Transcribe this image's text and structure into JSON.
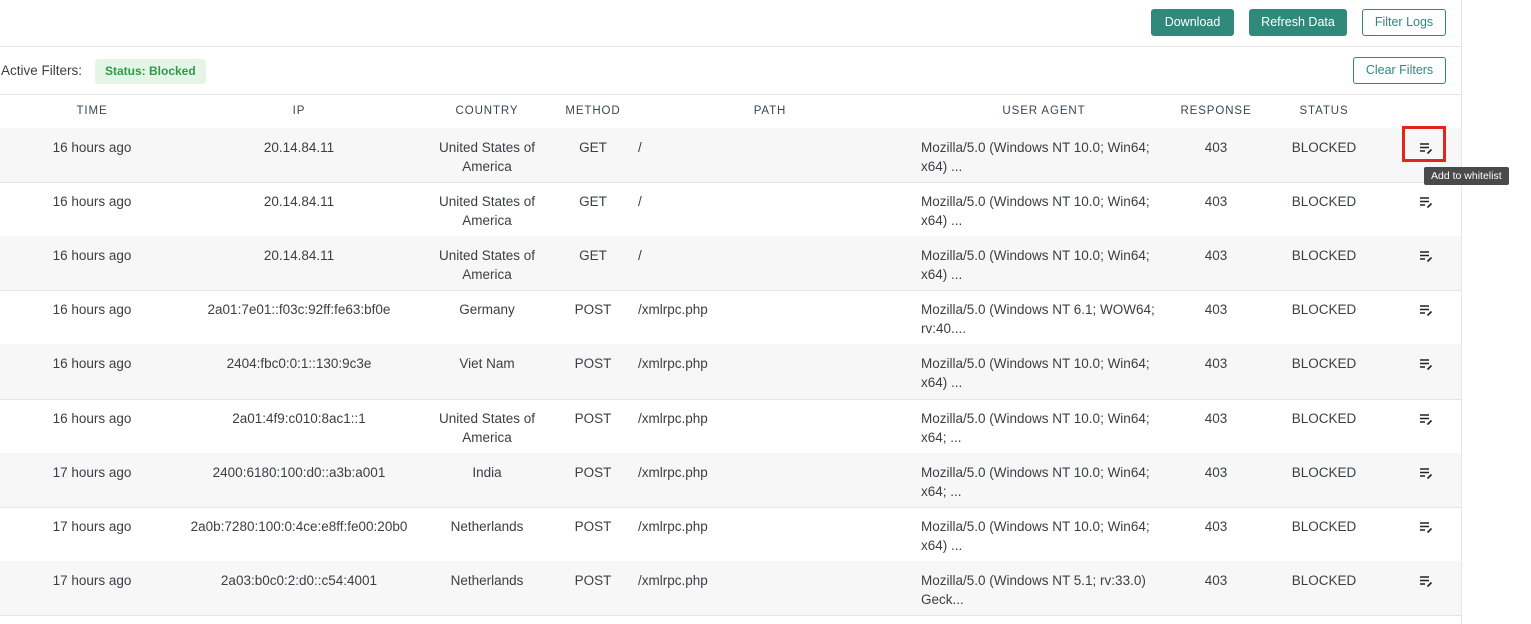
{
  "toolbar": {
    "download_label": "Download",
    "refresh_label": "Refresh Data",
    "filter_logs_label": "Filter Logs"
  },
  "filters": {
    "label": "Active Filters:",
    "chips": [
      "Status: Blocked"
    ],
    "clear_label": "Clear Filters"
  },
  "table": {
    "columns": [
      "TIME",
      "IP",
      "COUNTRY",
      "METHOD",
      "PATH",
      "USER AGENT",
      "RESPONSE",
      "STATUS"
    ],
    "rows": [
      {
        "time": "16 hours ago",
        "ip": "20.14.84.11",
        "country": "United States of America",
        "method": "GET",
        "path": "/",
        "user_agent": "Mozilla/5.0 (Windows NT 10.0; Win64; x64) ...",
        "response": "403",
        "status": "BLOCKED"
      },
      {
        "time": "16 hours ago",
        "ip": "20.14.84.11",
        "country": "United States of America",
        "method": "GET",
        "path": "/",
        "user_agent": "Mozilla/5.0 (Windows NT 10.0; Win64; x64) ...",
        "response": "403",
        "status": "BLOCKED"
      },
      {
        "time": "16 hours ago",
        "ip": "20.14.84.11",
        "country": "United States of America",
        "method": "GET",
        "path": "/",
        "user_agent": "Mozilla/5.0 (Windows NT 10.0; Win64; x64) ...",
        "response": "403",
        "status": "BLOCKED"
      },
      {
        "time": "16 hours ago",
        "ip": "2a01:7e01::f03c:92ff:fe63:bf0e",
        "country": "Germany",
        "method": "POST",
        "path": "/xmlrpc.php",
        "user_agent": "Mozilla/5.0 (Windows NT 6.1; WOW64; rv:40....",
        "response": "403",
        "status": "BLOCKED"
      },
      {
        "time": "16 hours ago",
        "ip": "2404:fbc0:0:1::130:9c3e",
        "country": "Viet Nam",
        "method": "POST",
        "path": "/xmlrpc.php",
        "user_agent": "Mozilla/5.0 (Windows NT 10.0; Win64; x64) ...",
        "response": "403",
        "status": "BLOCKED"
      },
      {
        "time": "16 hours ago",
        "ip": "2a01:4f9:c010:8ac1::1",
        "country": "United States of America",
        "method": "POST",
        "path": "/xmlrpc.php",
        "user_agent": "Mozilla/5.0 (Windows NT 10.0; Win64; x64; ...",
        "response": "403",
        "status": "BLOCKED"
      },
      {
        "time": "17 hours ago",
        "ip": "2400:6180:100:d0::a3b:a001",
        "country": "India",
        "method": "POST",
        "path": "/xmlrpc.php",
        "user_agent": "Mozilla/5.0 (Windows NT 10.0; Win64; x64; ...",
        "response": "403",
        "status": "BLOCKED"
      },
      {
        "time": "17 hours ago",
        "ip": "2a0b:7280:100:0:4ce:e8ff:fe00:20b0",
        "country": "Netherlands",
        "method": "POST",
        "path": "/xmlrpc.php",
        "user_agent": "Mozilla/5.0 (Windows NT 10.0; Win64; x64) ...",
        "response": "403",
        "status": "BLOCKED"
      },
      {
        "time": "17 hours ago",
        "ip": "2a03:b0c0:2:d0::c54:4001",
        "country": "Netherlands",
        "method": "POST",
        "path": "/xmlrpc.php",
        "user_agent": "Mozilla/5.0 (Windows NT 5.1; rv:33.0) Geck...",
        "response": "403",
        "status": "BLOCKED"
      }
    ],
    "row_action_icon": "add-to-whitelist-icon"
  },
  "tooltip": {
    "text": "Add to whitelist"
  },
  "colors": {
    "accent": "#2f8a7c",
    "chip_bg": "#e4f4e6",
    "chip_text": "#2f9a4b",
    "highlight": "#e2261b",
    "tooltip_bg": "#4a4a4a"
  }
}
